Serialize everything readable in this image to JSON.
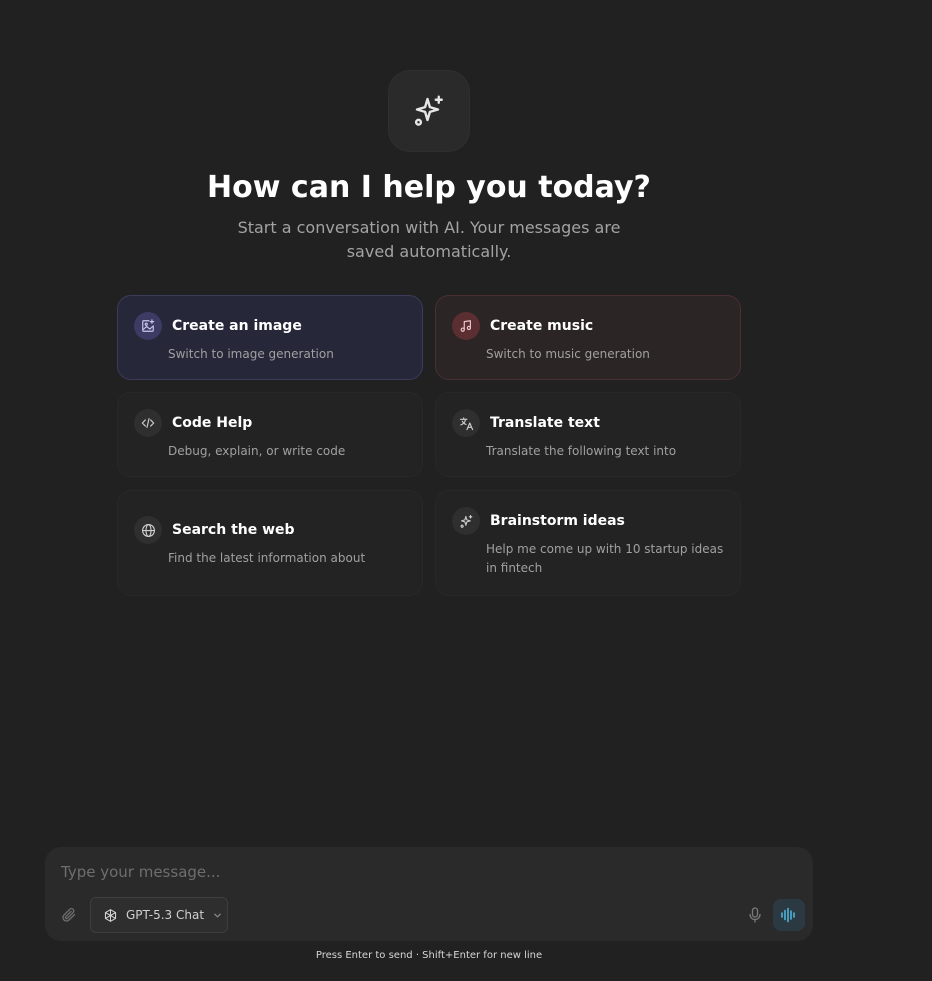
{
  "hero": {
    "icon": "sparkles-icon",
    "title": "How can I help you today?",
    "subtitle": "Start a conversation with AI. Your messages are saved automatically."
  },
  "suggestions": [
    {
      "title": "Create an image",
      "description": "Switch to image generation",
      "icon": "image-plus-icon",
      "accent": "#3d3b63"
    },
    {
      "title": "Create music",
      "description": "Switch to music generation",
      "icon": "music-note-icon",
      "accent": "#5b2e32"
    },
    {
      "title": "Code Help",
      "description": "Debug, explain, or write code",
      "icon": "code-icon"
    },
    {
      "title": "Translate text",
      "description": "Translate the following text into",
      "icon": "translate-icon"
    },
    {
      "title": "Search the web",
      "description": "Find the latest information about",
      "icon": "globe-icon"
    },
    {
      "title": "Brainstorm ideas",
      "description": "Help me come up with 10 startup ideas in fintech",
      "icon": "sparkles-icon"
    }
  ],
  "composer": {
    "placeholder": "Type your message...",
    "model_label": "GPT-5.3 Chat",
    "model_icon": "openai-logo-icon",
    "voice_accent": "#4fb3d9"
  },
  "hint": {
    "text": "Press Enter to send · Shift+Enter for new line"
  }
}
